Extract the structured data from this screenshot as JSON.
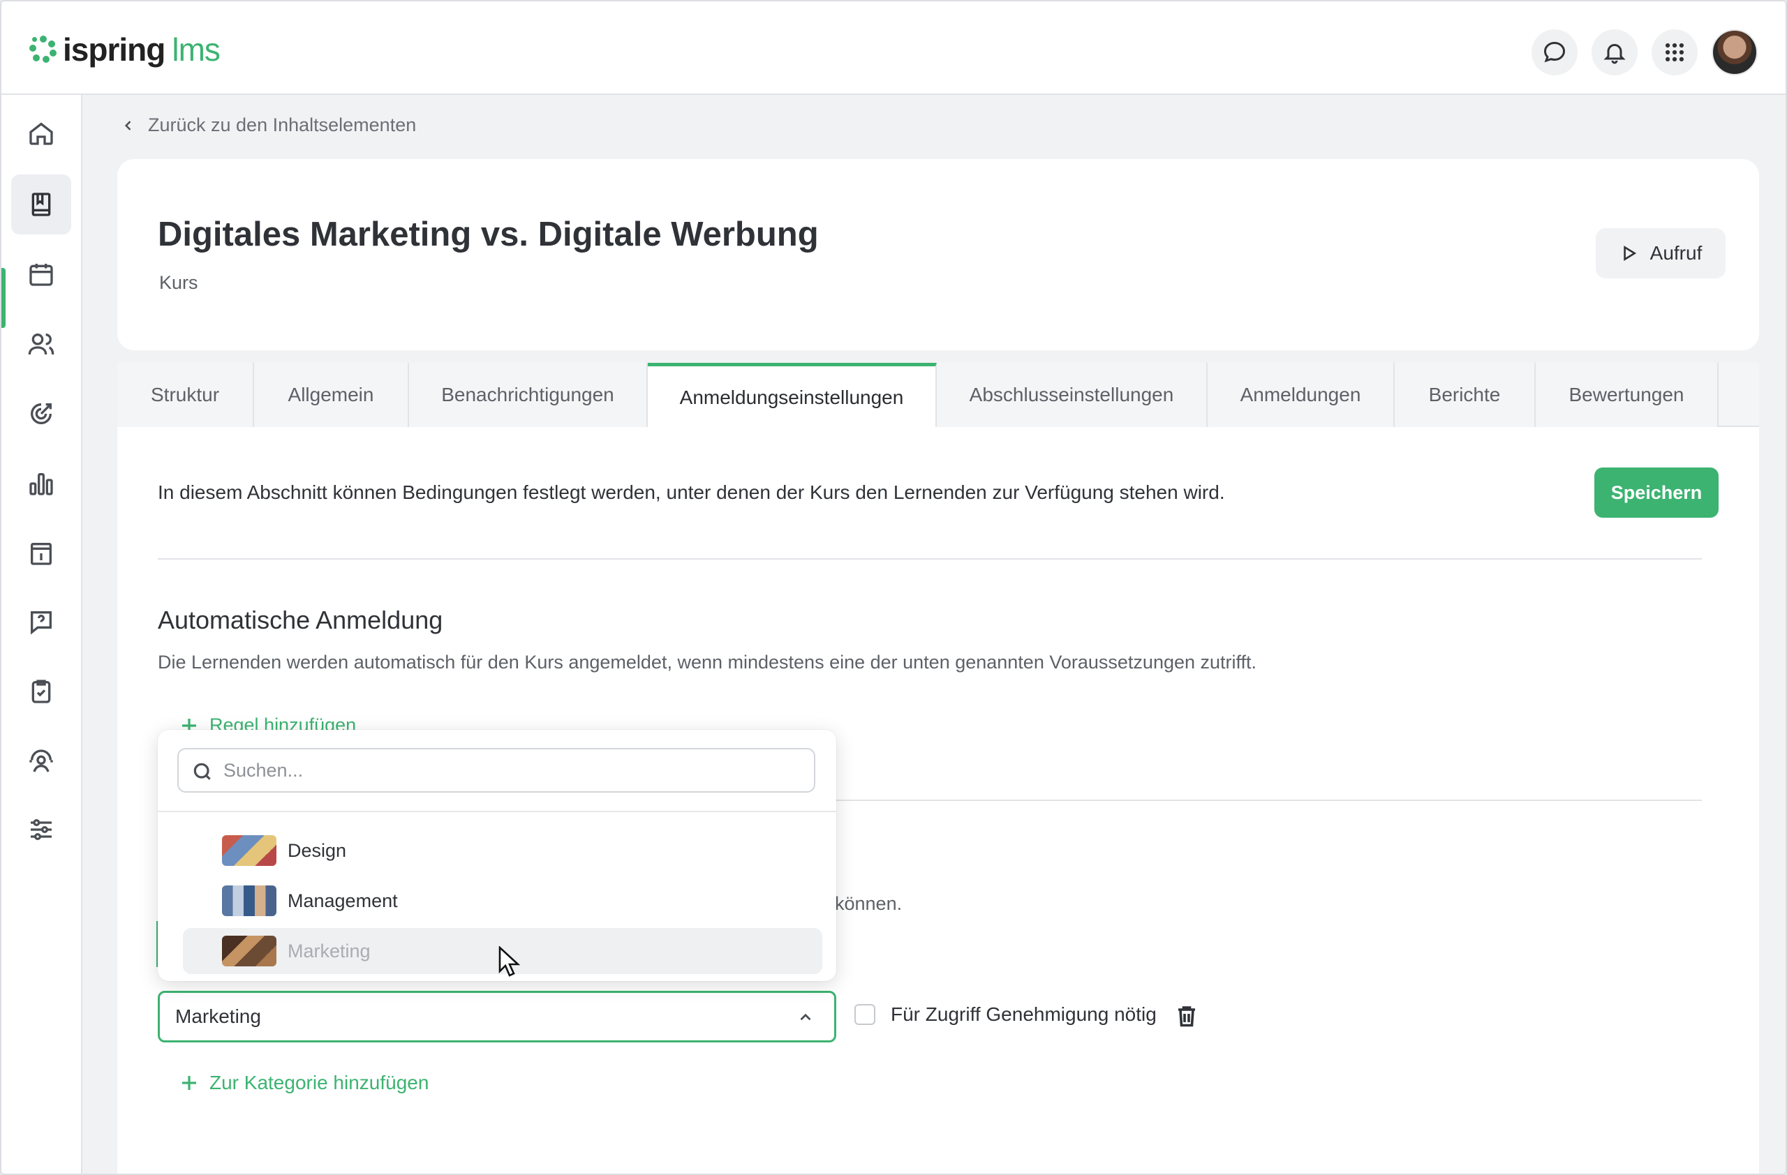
{
  "brand": {
    "name": "ispring",
    "product": "lms",
    "accent": "#3cb371"
  },
  "topbar": {
    "icons": [
      "chat-icon",
      "bell-icon",
      "apps-grid-icon"
    ],
    "avatar_alt": "user-avatar"
  },
  "sidebar": {
    "items": [
      {
        "icon": "home-icon"
      },
      {
        "icon": "book-icon",
        "active": true
      },
      {
        "icon": "calendar-icon"
      },
      {
        "icon": "users-icon"
      },
      {
        "icon": "target-icon"
      },
      {
        "icon": "bar-chart-icon"
      },
      {
        "icon": "info-calendar-icon"
      },
      {
        "icon": "question-chat-icon"
      },
      {
        "icon": "clipboard-check-icon"
      },
      {
        "icon": "support-icon"
      },
      {
        "icon": "sliders-icon"
      }
    ]
  },
  "breadcrumb": {
    "back_label": "Zurück zu den Inhaltselementen"
  },
  "course": {
    "title": "Digitales Marketing vs. Digitale Werbung",
    "type": "Kurs",
    "launch_label": "Aufruf"
  },
  "tabs": [
    {
      "label": "Struktur"
    },
    {
      "label": "Allgemein"
    },
    {
      "label": "Benachrichtigungen"
    },
    {
      "label": "Anmeldungseinstellungen",
      "active": true
    },
    {
      "label": "Abschlusseinstellungen"
    },
    {
      "label": "Anmeldungen"
    },
    {
      "label": "Berichte"
    },
    {
      "label": "Bewertungen"
    }
  ],
  "content": {
    "intro": "In diesem Abschnitt können Bedingungen festlegt werden, unter denen der Kurs den Lernenden zur Verfügung stehen wird.",
    "save_label": "Speichern",
    "auto_section": {
      "title": "Automatische Anmeldung",
      "description": "Die Lernenden werden automatisch für den Kurs angemeldet, wenn mindestens eine der unten genannten Voraussetzungen zutrifft.",
      "add_rule_label": "Regel hinzufügen"
    },
    "obscured_text_tail": "können.",
    "category_select": {
      "value": "Marketing"
    },
    "approval_label": "Für Zugriff Genehmigung nötig",
    "approval_checked": false,
    "add_category_label": "Zur Kategorie hinzufügen"
  },
  "dropdown": {
    "search_placeholder": "Suchen...",
    "options": [
      {
        "label": "Design"
      },
      {
        "label": "Management"
      },
      {
        "label": "Marketing",
        "hovered": true
      }
    ]
  }
}
